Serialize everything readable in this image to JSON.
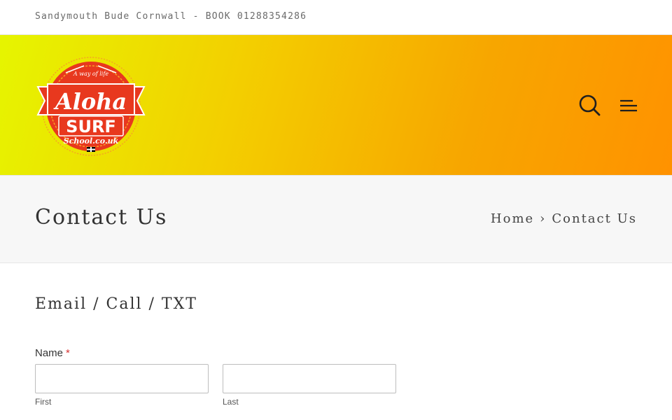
{
  "topbar": {
    "text": "Sandymouth Bude Cornwall - BOOK 01288354286"
  },
  "header": {
    "logo": {
      "small_text": "A way of life",
      "line1": "Aloha",
      "line2": "SURF",
      "line3": "School.co.uk",
      "colors": {
        "red": "#e8381e",
        "orange": "#f7a224",
        "white": "#ffffff"
      }
    },
    "icons": {
      "search": "search-icon",
      "menu": "menu-icon"
    }
  },
  "page_title": {
    "title": "Contact Us",
    "breadcrumb": {
      "home": "Home",
      "separator": "›",
      "current": "Contact Us"
    }
  },
  "form": {
    "section_title": "Email / Call / TXT",
    "name_label": "Name",
    "required_marker": "*",
    "first_value": "",
    "last_value": "",
    "first_sublabel": "First",
    "last_sublabel": "Last"
  }
}
